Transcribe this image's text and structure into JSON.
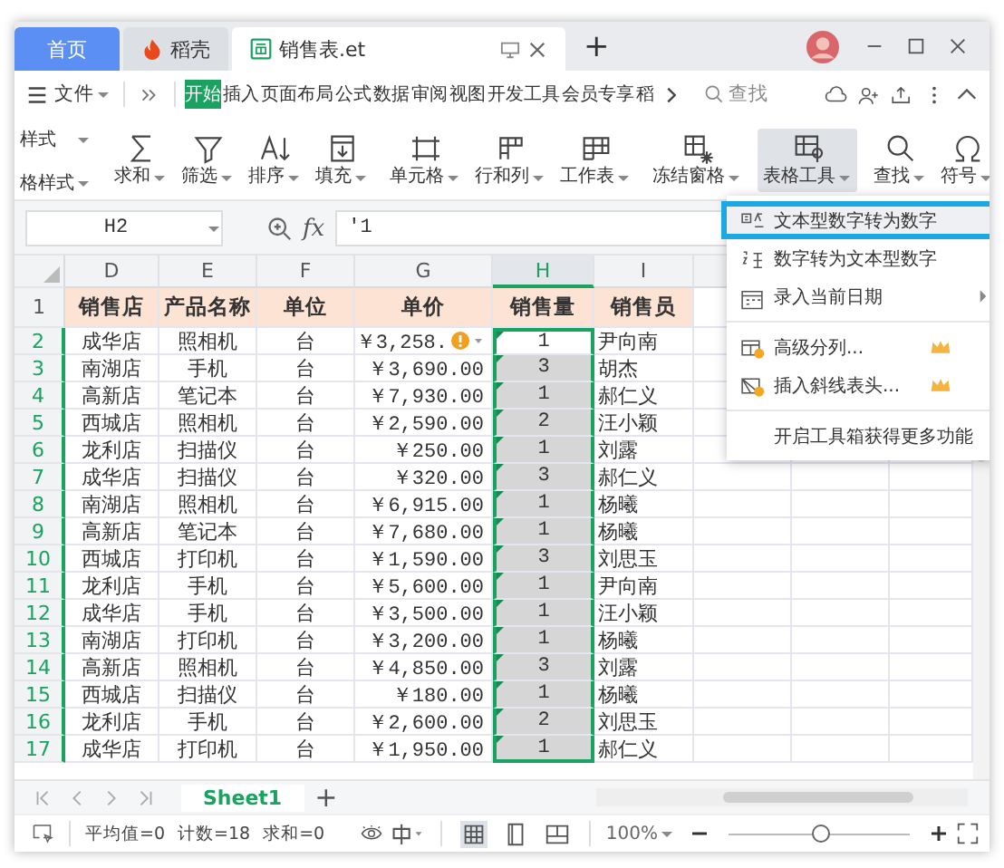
{
  "tabs": [
    {
      "label": "首页",
      "kind": "home",
      "selected": false
    },
    {
      "label": "稻壳",
      "kind": "docer",
      "selected": false
    },
    {
      "label": "销售表.et",
      "kind": "sheet",
      "selected": true
    }
  ],
  "add_tab": "+",
  "menu": {
    "file": "文件",
    "items": [
      {
        "label": "开始",
        "selected": true
      },
      {
        "label": "插入",
        "selected": false
      },
      {
        "label": "页面布局",
        "selected": false
      },
      {
        "label": "公式",
        "selected": false
      },
      {
        "label": "数据",
        "selected": false
      },
      {
        "label": "审阅",
        "selected": false
      },
      {
        "label": "视图",
        "selected": false
      },
      {
        "label": "开发工具",
        "selected": false
      },
      {
        "label": "会员专享",
        "selected": false
      },
      {
        "label": "稻",
        "selected": false
      }
    ],
    "search": "查找"
  },
  "ribbon": {
    "styles": [
      "样式",
      "格样式"
    ],
    "groups": [
      [
        {
          "label": "求和",
          "pressed": false
        },
        {
          "label": "筛选",
          "pressed": false
        },
        {
          "label": "排序",
          "pressed": false
        },
        {
          "label": "填充",
          "pressed": false
        }
      ],
      [
        {
          "label": "单元格",
          "pressed": false
        },
        {
          "label": "行和列",
          "pressed": false
        },
        {
          "label": "工作表",
          "pressed": false
        }
      ],
      [
        {
          "label": "冻结窗格",
          "pressed": false
        }
      ],
      [
        {
          "label": "表格工具",
          "pressed": true
        }
      ],
      [
        {
          "label": "查找",
          "pressed": false
        },
        {
          "label": "符号",
          "pressed": false
        }
      ]
    ]
  },
  "formula_bar": {
    "cell": "H2",
    "fx": "fx",
    "value": "'1"
  },
  "columns": [
    {
      "label": "D",
      "selected": false
    },
    {
      "label": "E",
      "selected": false
    },
    {
      "label": "F",
      "selected": false
    },
    {
      "label": "G",
      "selected": false
    },
    {
      "label": "H",
      "selected": true
    },
    {
      "label": "I",
      "selected": false
    }
  ],
  "header_row": {
    "number": "1",
    "cells": [
      "销售店",
      "产品名称",
      "单位",
      "单价",
      "销售量",
      "销售员"
    ]
  },
  "rows": [
    {
      "number": "2",
      "selected": true,
      "active": true,
      "warning": true,
      "cells": [
        "成华店",
        "照相机",
        "台",
        "￥3,258.",
        "1",
        "尹向南"
      ]
    },
    {
      "number": "3",
      "selected": true,
      "active": false,
      "warning": false,
      "cells": [
        "南湖店",
        "手机",
        "台",
        "￥3,690.00",
        "3",
        "胡杰"
      ]
    },
    {
      "number": "4",
      "selected": true,
      "active": false,
      "warning": false,
      "cells": [
        "高新店",
        "笔记本",
        "台",
        "￥7,930.00",
        "1",
        "郝仁义"
      ]
    },
    {
      "number": "5",
      "selected": true,
      "active": false,
      "warning": false,
      "cells": [
        "西城店",
        "照相机",
        "台",
        "￥2,590.00",
        "2",
        "汪小颖"
      ]
    },
    {
      "number": "6",
      "selected": true,
      "active": false,
      "warning": false,
      "cells": [
        "龙利店",
        "扫描仪",
        "台",
        "￥250.00",
        "1",
        "刘露"
      ]
    },
    {
      "number": "7",
      "selected": true,
      "active": false,
      "warning": false,
      "cells": [
        "成华店",
        "扫描仪",
        "台",
        "￥320.00",
        "3",
        "郝仁义"
      ]
    },
    {
      "number": "8",
      "selected": true,
      "active": false,
      "warning": false,
      "cells": [
        "南湖店",
        "照相机",
        "台",
        "￥6,915.00",
        "1",
        "杨曦"
      ]
    },
    {
      "number": "9",
      "selected": true,
      "active": false,
      "warning": false,
      "cells": [
        "高新店",
        "笔记本",
        "台",
        "￥7,680.00",
        "1",
        "杨曦"
      ]
    },
    {
      "number": "10",
      "selected": true,
      "active": false,
      "warning": false,
      "cells": [
        "西城店",
        "打印机",
        "台",
        "￥1,590.00",
        "3",
        "刘思玉"
      ]
    },
    {
      "number": "11",
      "selected": true,
      "active": false,
      "warning": false,
      "cells": [
        "龙利店",
        "手机",
        "台",
        "￥5,600.00",
        "1",
        "尹向南"
      ]
    },
    {
      "number": "12",
      "selected": true,
      "active": false,
      "warning": false,
      "cells": [
        "成华店",
        "手机",
        "台",
        "￥3,500.00",
        "1",
        "汪小颖"
      ]
    },
    {
      "number": "13",
      "selected": true,
      "active": false,
      "warning": false,
      "cells": [
        "南湖店",
        "打印机",
        "台",
        "￥3,200.00",
        "1",
        "杨曦"
      ]
    },
    {
      "number": "14",
      "selected": true,
      "active": false,
      "warning": false,
      "cells": [
        "高新店",
        "照相机",
        "台",
        "￥4,850.00",
        "3",
        "刘露"
      ]
    },
    {
      "number": "15",
      "selected": true,
      "active": false,
      "warning": false,
      "cells": [
        "西城店",
        "扫描仪",
        "台",
        "￥180.00",
        "1",
        "杨曦"
      ]
    },
    {
      "number": "16",
      "selected": true,
      "active": false,
      "warning": false,
      "cells": [
        "龙利店",
        "手机",
        "台",
        "￥2,600.00",
        "2",
        "刘思玉"
      ]
    },
    {
      "number": "17",
      "selected": true,
      "active": false,
      "warning": false,
      "cells": [
        "成华店",
        "打印机",
        "台",
        "￥1,950.00",
        "1",
        "郝仁义"
      ]
    }
  ],
  "context_menu": [
    {
      "kind": "item",
      "label": "文本型数字转为数字",
      "highlighted": true
    },
    {
      "kind": "item",
      "label": "数字转为文本型数字",
      "highlighted": false
    },
    {
      "kind": "submenu",
      "label": "录入当前日期",
      "highlighted": false
    },
    {
      "kind": "divider"
    },
    {
      "kind": "premium",
      "label": "高级分列...",
      "highlighted": false
    },
    {
      "kind": "premium",
      "label": "插入斜线表头...",
      "highlighted": false
    },
    {
      "kind": "divider"
    },
    {
      "kind": "footer",
      "label": "开启工具箱获得更多功能",
      "highlighted": false
    }
  ],
  "sheets": [
    {
      "label": "Sheet1",
      "selected": true
    }
  ],
  "add_sheet": "+",
  "status_bar": {
    "stats": [
      "平均值=0",
      "计数=18",
      "求和=0"
    ],
    "view_modes": [
      {
        "selected": true
      },
      {
        "selected": false
      },
      {
        "selected": false
      }
    ],
    "zoom": "100%",
    "zoom_slider": {
      "level": 0.5
    }
  }
}
